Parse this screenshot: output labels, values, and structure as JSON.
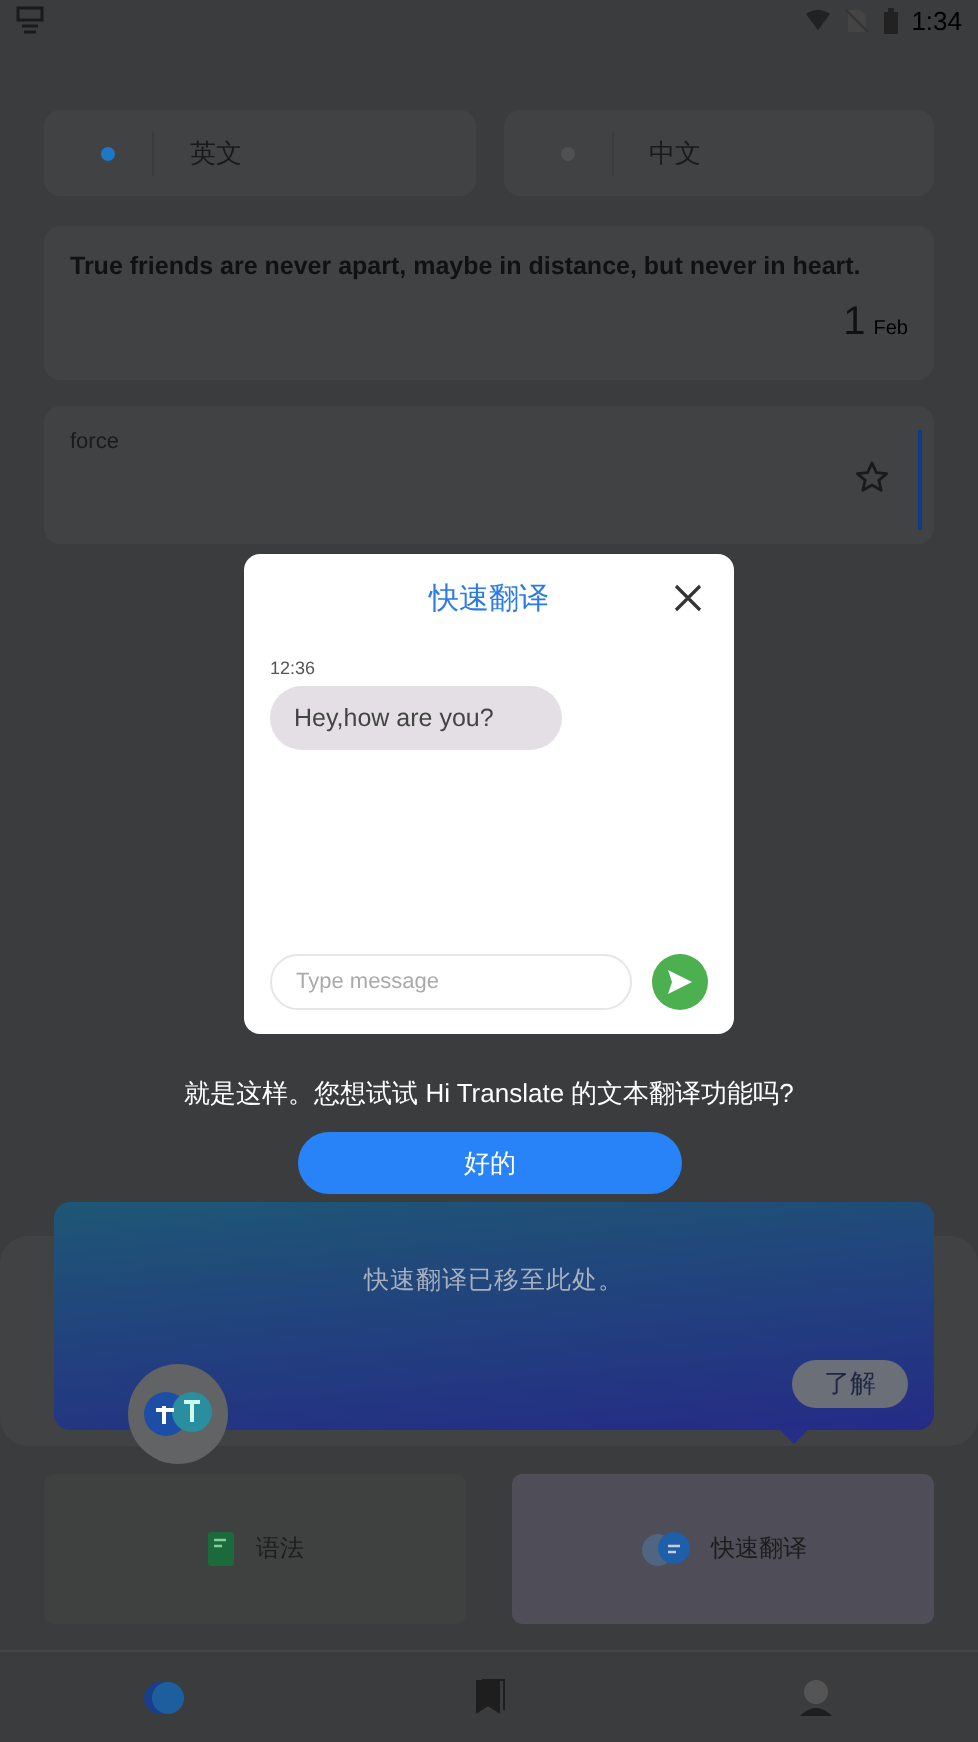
{
  "status_bar": {
    "time": "1:34"
  },
  "languages": [
    {
      "label": "英文",
      "selected": true
    },
    {
      "label": "中文",
      "selected": false
    }
  ],
  "quote_card": {
    "text": "True friends are never apart, maybe in distance, but never in heart.",
    "day": "1",
    "month": "Feb"
  },
  "word_card": {
    "word": "force",
    "starred": false
  },
  "dialog": {
    "title": "快速翻译",
    "time": "12:36",
    "message": "Hey,how are you?",
    "input": {
      "placeholder": "Type message"
    }
  },
  "prompt": {
    "text": "就是这样。您想试试 Hi Translate 的文本翻译功能吗?",
    "button": "好的"
  },
  "tooltip": {
    "text": "快速翻译已移至此处。",
    "button": "了解"
  },
  "features": [
    {
      "kind": "book",
      "label": "语法",
      "highlighted": false
    },
    {
      "kind": "bubble",
      "label": "快速翻译",
      "highlighted": true
    }
  ],
  "nav": [
    {
      "kind": "translate",
      "selected": true
    },
    {
      "kind": "bookmark",
      "selected": false
    },
    {
      "kind": "profile",
      "selected": false
    }
  ]
}
